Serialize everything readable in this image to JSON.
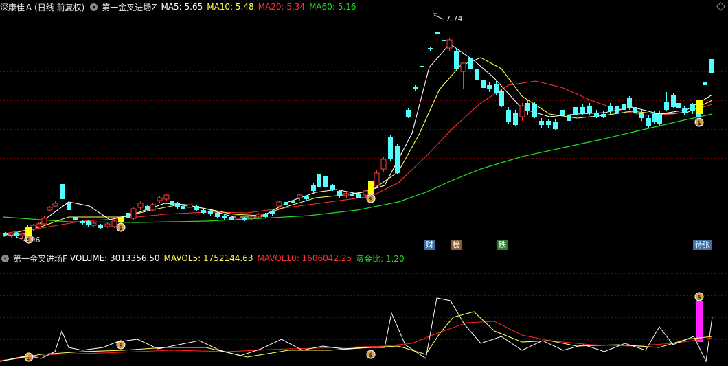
{
  "header": {
    "stock_name": "深康佳Ａ",
    "period": "(日线 前复权)",
    "indicator": "第一金叉进场Z",
    "ma5": "MA5: 5.65",
    "ma10": "MA10: 5.48",
    "ma20": "MA20: 5.34",
    "ma60": "MA60: 5.16"
  },
  "lower_header": {
    "indicator": "第一金叉进场F",
    "volume": "VOLUME: 3013356.50",
    "mavol5": "MAVOL5: 1752144.63",
    "mavol10": "MAVOL10: 1606042.25",
    "fund_ratio": "资金比: 1.20"
  },
  "annotations": {
    "high": "7.74",
    "low": "4.96",
    "signal_glyph": "$"
  },
  "badges": [
    {
      "label": "财",
      "bg": "#3a6ea5",
      "fg": "#fff"
    },
    {
      "label": "榜",
      "bg": "#8b5a2b",
      "fg": "#fff"
    },
    {
      "label": "跌",
      "bg": "#2e7d32",
      "fg": "#fff"
    },
    {
      "label": "待张",
      "bg": "#3a6ea5",
      "fg": "#fff"
    }
  ],
  "colors": {
    "up": "#ff3a3a",
    "down": "#54ffff",
    "ma5": "#ffffff",
    "ma10": "#ffff55",
    "ma20": "#ff3030",
    "ma60": "#22dd22",
    "signal": "#ffff00",
    "volume_signal": "#ff22ff"
  }
}
